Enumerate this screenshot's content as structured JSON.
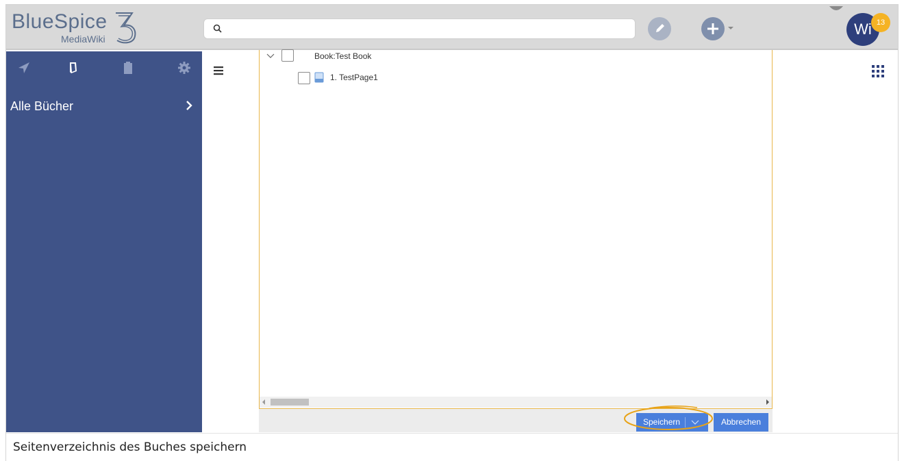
{
  "logo": {
    "main": "BlueSpice",
    "sub": "MediaWiki",
    "number": "3"
  },
  "search": {
    "placeholder": "",
    "value": ""
  },
  "user": {
    "initials": "Wi",
    "notification_count": "13"
  },
  "sidebar": {
    "tabs": [
      "navigation-icon",
      "book-icon",
      "clipboard-icon",
      "gear-icon"
    ],
    "items": [
      {
        "label": "Alle Bücher"
      }
    ]
  },
  "tree": {
    "root": {
      "label": "Book:Test Book"
    },
    "children": [
      {
        "label": "1. TestPage1"
      }
    ]
  },
  "buttons": {
    "save_label": "Speichern",
    "cancel_label": "Abbrechen"
  },
  "caption": "Seitenverzeichnis des Buches speichern",
  "colors": {
    "sidebar": "#3f5388",
    "accent": "#4a7fdc",
    "highlight": "#e8a317",
    "avatar": "#2e3f7c",
    "badge": "#f5b324"
  }
}
